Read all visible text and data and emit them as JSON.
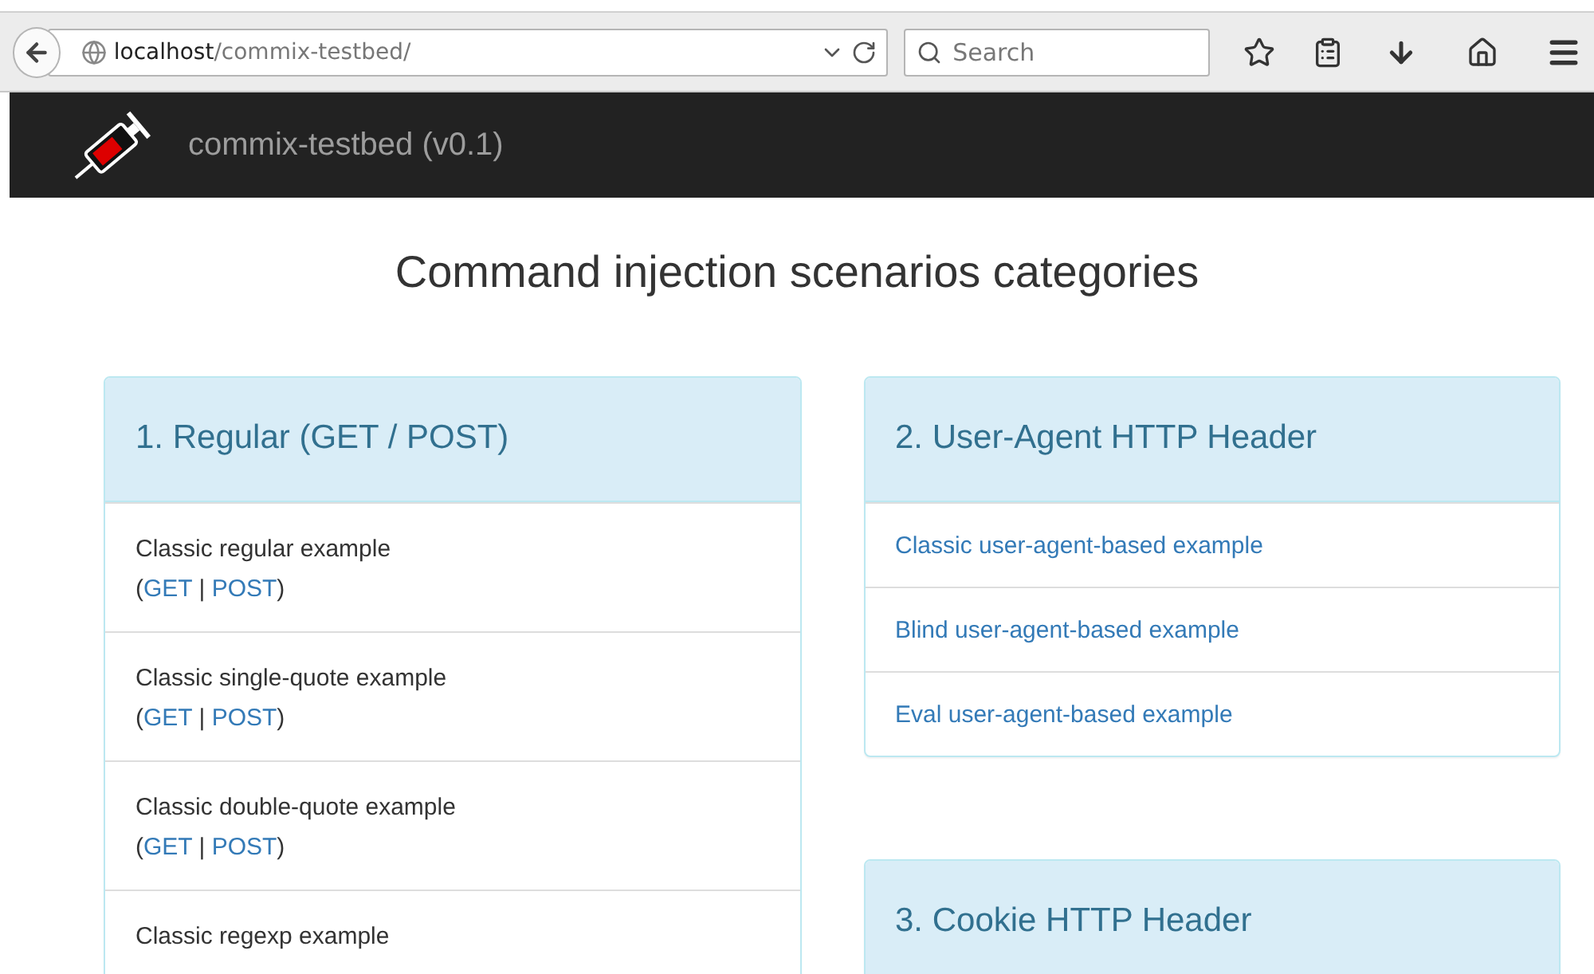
{
  "browser": {
    "url_host": "localhost",
    "url_path": "/commix-testbed/",
    "search": {
      "placeholder": "Search"
    }
  },
  "navbar": {
    "brand": "commix-testbed (v0.1)"
  },
  "heading": "Command injection scenarios categories",
  "columns": [
    [
      {
        "title": "1. Regular (GET / POST)",
        "items": [
          {
            "kind": "methods",
            "label": "Classic regular example",
            "open": "(",
            "links": [
              "GET",
              "POST"
            ],
            "separator": "|",
            "close": ")"
          },
          {
            "kind": "methods",
            "label": "Classic single-quote example",
            "open": "(",
            "links": [
              "GET",
              "POST"
            ],
            "separator": "|",
            "close": ")"
          },
          {
            "kind": "methods",
            "label": "Classic double-quote example",
            "open": "(",
            "links": [
              "GET",
              "POST"
            ],
            "separator": "|",
            "close": ")"
          },
          {
            "kind": "methods",
            "label": "Classic regexp example"
          }
        ]
      }
    ],
    [
      {
        "title": "2. User-Agent HTTP Header",
        "items": [
          {
            "kind": "link",
            "label": "Classic user-agent-based example"
          },
          {
            "kind": "link",
            "label": "Blind user-agent-based example"
          },
          {
            "kind": "link",
            "label": "Eval user-agent-based example"
          }
        ]
      },
      {
        "title": "3. Cookie HTTP Header"
      }
    ]
  ]
}
